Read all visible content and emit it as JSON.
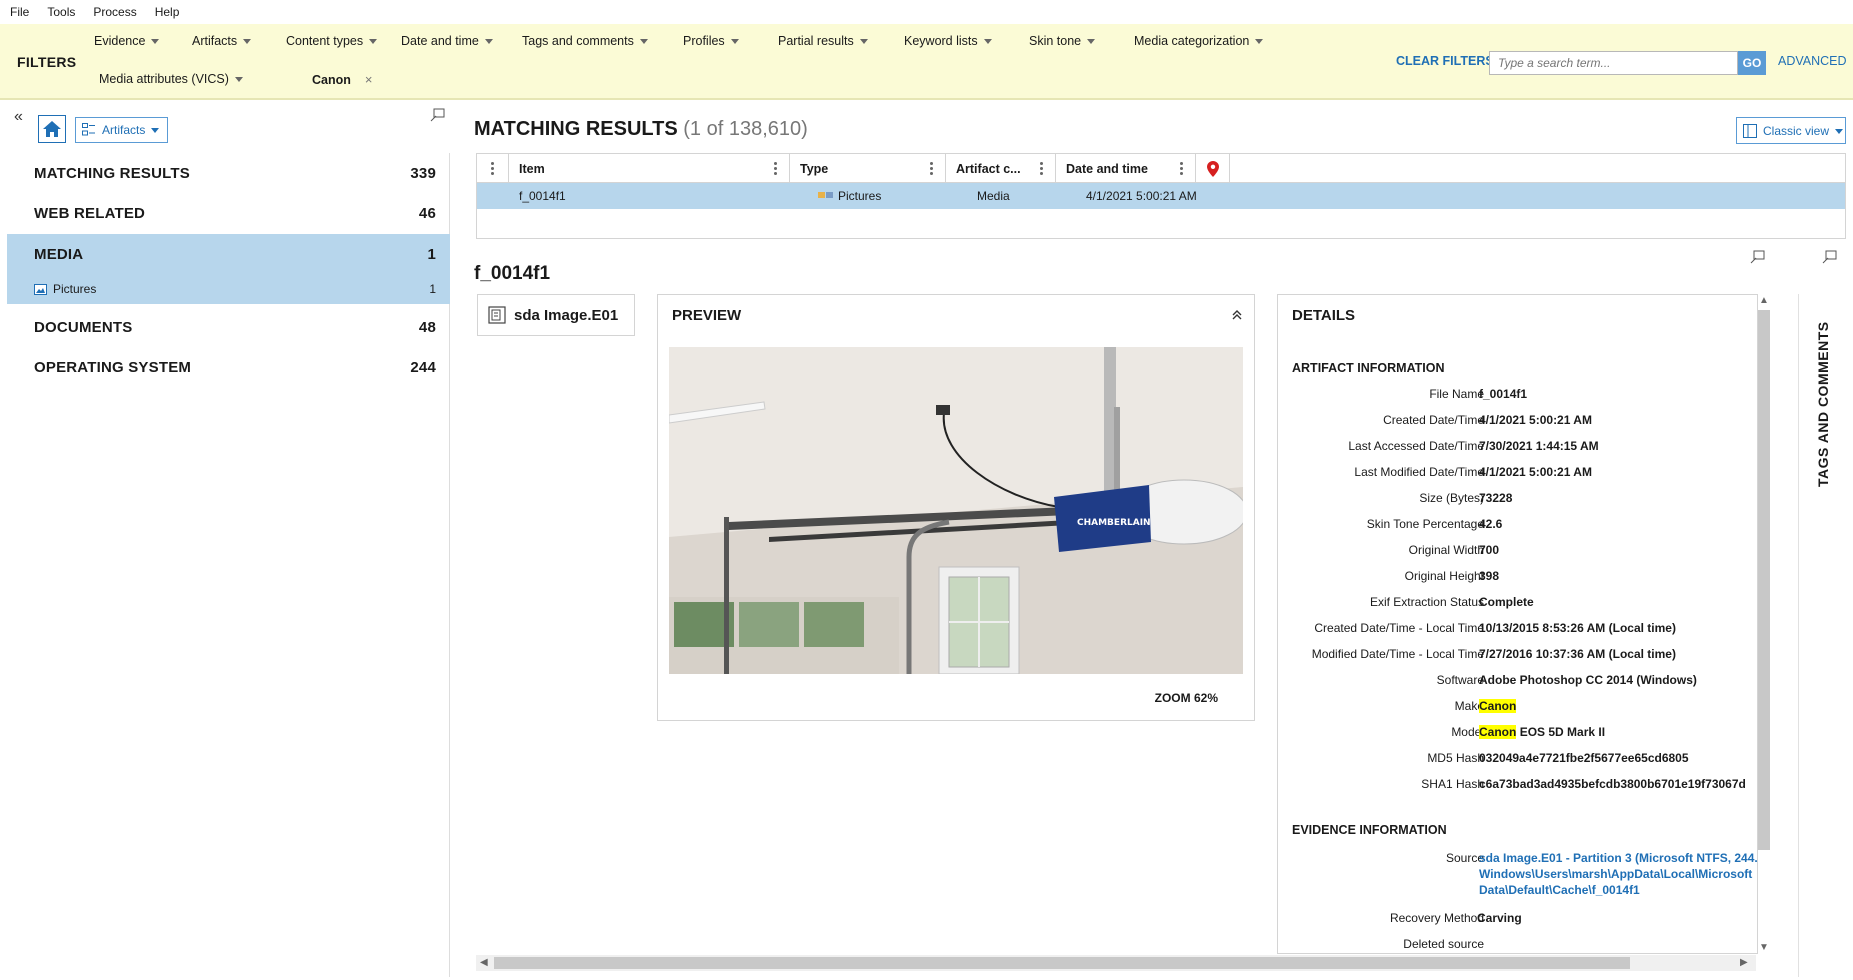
{
  "menu": [
    "File",
    "Tools",
    "Process",
    "Help"
  ],
  "filters": {
    "label": "FILTERS",
    "row1": [
      "Evidence",
      "Artifacts",
      "Content types",
      "Date and time",
      "Tags and comments",
      "Profiles",
      "Partial results",
      "Keyword lists",
      "Skin tone",
      "Media categorization"
    ],
    "row2": [
      "Media attributes (VICS)"
    ],
    "active_chip": "Canon",
    "chip_close": "×",
    "clear": "CLEAR FILTERS",
    "search_placeholder": "Type a search term...",
    "go": "GO",
    "advanced": "ADVANCED"
  },
  "left": {
    "scope_dropdown": "Artifacts",
    "categories": [
      {
        "label": "MATCHING RESULTS",
        "count": "339"
      },
      {
        "label": "WEB RELATED",
        "count": "46"
      },
      {
        "label": "MEDIA",
        "count": "1"
      },
      {
        "label": "DOCUMENTS",
        "count": "48"
      },
      {
        "label": "OPERATING SYSTEM",
        "count": "244"
      }
    ],
    "subcategory": {
      "label": "Pictures",
      "count": "1"
    }
  },
  "results": {
    "title": "MATCHING RESULTS",
    "count": "(1 of 138,610)",
    "view": "Classic view",
    "columns": [
      "Item",
      "Type",
      "Artifact c...",
      "Date and time"
    ],
    "row": {
      "item": "f_0014f1",
      "type": "Pictures",
      "artifact": "Media",
      "date": "4/1/2021 5:00:21 AM"
    }
  },
  "item": {
    "title": "f_0014f1",
    "source": "sda Image.E01"
  },
  "preview": {
    "title": "PREVIEW",
    "zoom": "ZOOM 62%",
    "brand_on_device": "CHAMBERLAIN"
  },
  "details": {
    "title": "DETAILS",
    "artifact_section": "ARTIFACT INFORMATION",
    "fields": [
      {
        "label": "File Name",
        "value": "f_0014f1"
      },
      {
        "label": "Created Date/Time",
        "value": "4/1/2021 5:00:21 AM"
      },
      {
        "label": "Last Accessed Date/Time",
        "value": "7/30/2021 1:44:15 AM"
      },
      {
        "label": "Last Modified Date/Time",
        "value": "4/1/2021 5:00:21 AM"
      },
      {
        "label": "Size (Bytes)",
        "value": "73228"
      },
      {
        "label": "Skin Tone Percentage",
        "value": "42.6"
      },
      {
        "label": "Original Width",
        "value": "700"
      },
      {
        "label": "Original Height",
        "value": "398"
      },
      {
        "label": "Exif Extraction Status",
        "value": "Complete"
      },
      {
        "label": "Created Date/Time - Local Time",
        "value": "10/13/2015 8:53:26 AM (Local time)"
      },
      {
        "label": "Modified Date/Time - Local Time",
        "value": "7/27/2016 10:37:36 AM (Local time)"
      },
      {
        "label": "Software",
        "value": "Adobe Photoshop CC 2014 (Windows)"
      },
      {
        "label": "Make",
        "value": "Canon"
      },
      {
        "label": "Model",
        "value": "EOS 5D Mark II",
        "highlight_prefix": "Canon"
      },
      {
        "label": "MD5 Hash",
        "value": "032049a4e7721fbe2f5677ee65cd6805"
      },
      {
        "label": "SHA1 Hash",
        "value": "c6a73bad3ad4935befcdb3800b6701e19f73067d"
      }
    ],
    "evidence_section": "EVIDENCE INFORMATION",
    "source_label": "Source",
    "source_lines": [
      "sda Image.E01 - Partition 3 (Microsoft NTFS, 244.",
      "Windows\\Users\\marsh\\AppData\\Local\\Microsoft",
      "Data\\Default\\Cache\\f_0014f1"
    ],
    "recovery_label": "Recovery Method",
    "recovery_value": "Carving",
    "deleted_label": "Deleted source"
  },
  "side_tab": "TAGS AND COMMENTS",
  "colors": {
    "filter_bar": "#fbfbd6",
    "selection": "#b7d6ec",
    "link": "#1f6fb5",
    "highlight": "#ffff00"
  }
}
